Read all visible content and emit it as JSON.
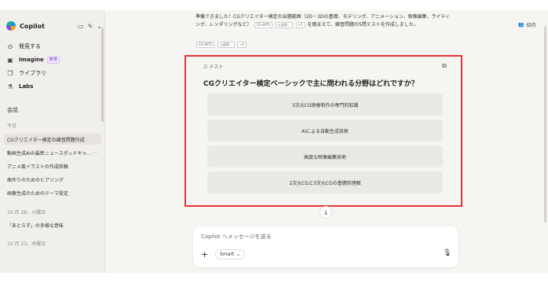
{
  "sidebar": {
    "brand": "Copilot",
    "nav": [
      {
        "label": "発見する",
        "icon": "compass-icon"
      },
      {
        "label": "Imagine",
        "icon": "image-icon",
        "badge": "新規"
      },
      {
        "label": "ライブラリ",
        "icon": "library-icon"
      },
      {
        "label": "Labs",
        "icon": "flask-icon"
      }
    ],
    "section_title": "会話",
    "today_label": "今日",
    "today_items": [
      "CGクリエイター検定の練習問題作成",
      "動画生成AIの最新ニュースポッドキャ...",
      "アニメ風イラストの作成依頼",
      "曲作りのためのヒアリング",
      "画像生成のためのテーマ設定"
    ],
    "date1": "10 月 28、火曜日",
    "date1_items": [
      "「あとらす」の多様な意味"
    ],
    "date2": "10 月 23、木曜日"
  },
  "main": {
    "share_label": "招待",
    "prev_line1": "準備できました！CGクリエイター検定の出題範囲（2D・3Dの基礎、モデリング、アニメーション、映像編集、ライティ",
    "prev_line2_a": "ング、レンダリングなど）",
    "prev_chip1": "CG-ARTS",
    "prev_chip2": "公益財...",
    "prev_chip3": "+2",
    "prev_line2_b": "を踏まえて、練習問題の5問テストを作成しました。",
    "src_chip1": "CG-ARTS",
    "src_chip2": "公益財...",
    "src_chip3": "+2",
    "quiz": {
      "header": "テスト",
      "question": "CGクリエイター検定ベーシックで主に問われる分野はどれですか？",
      "options": [
        "3次元CG映像制作の専門的知識",
        "AIによる自動生成技術",
        "高度な映像編集技術",
        "2次元CGと3次元CGの基礎的理解"
      ]
    },
    "composer": {
      "placeholder": "Copilot へメッセージを送る",
      "mode": "Smart"
    }
  },
  "colors": {
    "highlight": "#e3343a",
    "option_bg": "#ebe9e6"
  }
}
